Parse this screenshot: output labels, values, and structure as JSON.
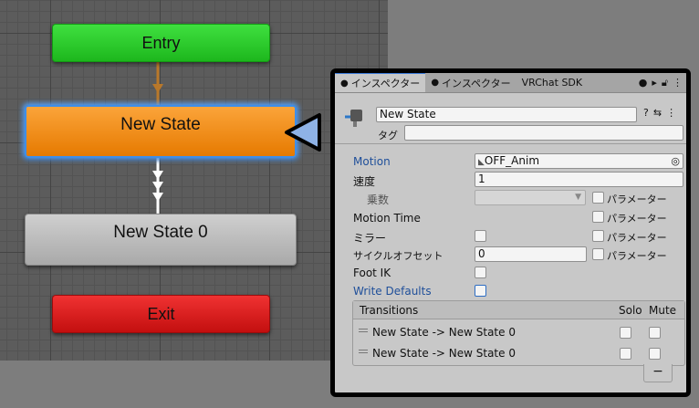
{
  "graph": {
    "nodes": {
      "entry": "Entry",
      "new_state": "New State",
      "new_state_0": "New State 0",
      "exit": "Exit"
    }
  },
  "inspector": {
    "tabs": [
      {
        "label": "インスペクター",
        "active": true
      },
      {
        "label": "インスペクター",
        "active": false
      },
      {
        "label": "VRChat SDK",
        "active": false
      }
    ],
    "state_name": "New State",
    "tag_label": "タグ",
    "tag_value": "",
    "fields": {
      "motion_label": "Motion",
      "motion_value": "OFF_Anim",
      "speed_label": "速度",
      "speed_value": "1",
      "multiplier_label": "乗数",
      "motion_time_label": "Motion Time",
      "mirror_label": "ミラー",
      "cycle_offset_label": "サイクルオフセット",
      "cycle_offset_value": "0",
      "foot_ik_label": "Foot IK",
      "write_defaults_label": "Write Defaults",
      "parameter_label": "パラメーター"
    },
    "transitions": {
      "header": "Transitions",
      "solo": "Solo",
      "mute": "Mute",
      "rows": [
        {
          "label": "New State -> New State 0"
        },
        {
          "label": "New State -> New State 0"
        }
      ],
      "remove": "−"
    }
  },
  "colors": {
    "entry": "#2bcf2b",
    "state_default": "#f28c12",
    "state_selected_border": "#3f8ee8",
    "state": "#bdbdbd",
    "exit": "#dc1f1f",
    "pointer": "#8eb2e6",
    "label_blue": "#1f4f9a"
  }
}
